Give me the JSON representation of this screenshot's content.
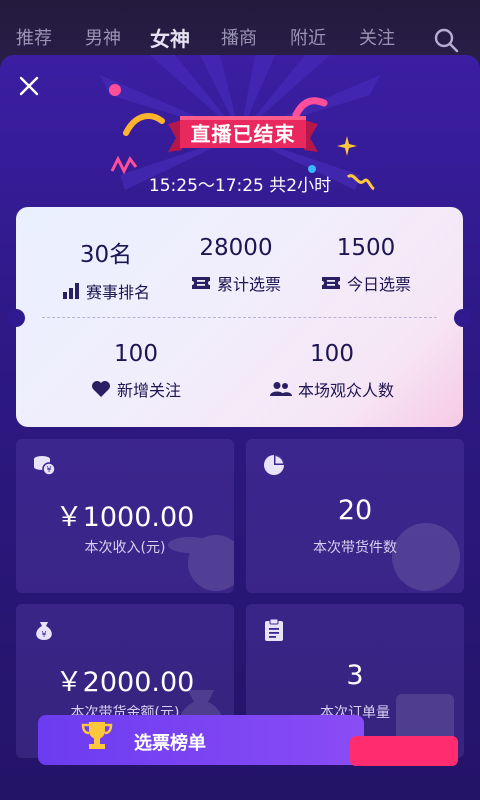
{
  "nav": {
    "tabs": [
      {
        "label": "推荐"
      },
      {
        "label": "男神"
      },
      {
        "label": "女神"
      },
      {
        "label": "播商"
      },
      {
        "label": "附近"
      },
      {
        "label": "关注"
      }
    ],
    "active_tab": "女神",
    "search_icon": "search-icon"
  },
  "modal": {
    "title": "直播已结束",
    "time_range": "15:25～17:25 共2小时",
    "ticket": {
      "rank_value": "30名",
      "rank_label": "赛事排名",
      "total_votes_value": "28000",
      "total_votes_label": "累计选票",
      "today_votes_value": "1500",
      "today_votes_label": "今日选票",
      "new_follows_value": "100",
      "new_follows_label": "新增关注",
      "viewers_value": "100",
      "viewers_label": "本场观众人数"
    },
    "stats": {
      "income_value": "￥1000.00",
      "income_label": "本次收入(元)",
      "items_value": "20",
      "items_label": "本次带货件数",
      "sales_value": "￥2000.00",
      "sales_label": "本次带货金额(元)",
      "orders_value": "3",
      "orders_label": "本次订单量"
    },
    "bottom_button_label": "选票榜单"
  },
  "colors": {
    "panel_top": "#3b1ea3",
    "panel_bottom": "#241467",
    "ribbon": "#e8285f",
    "accent_pink": "#ff2d6f",
    "ticket_text": "#1e1553"
  }
}
